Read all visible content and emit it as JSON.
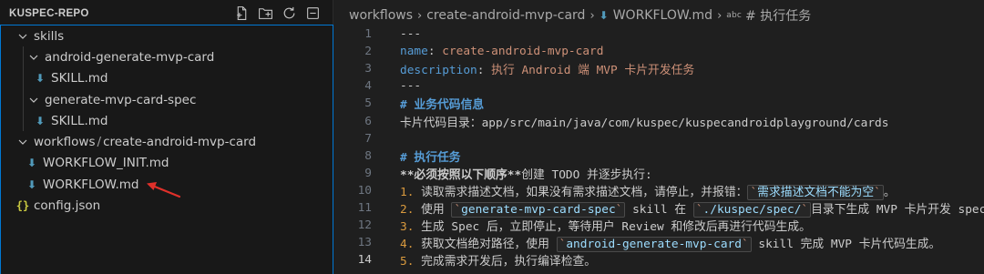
{
  "explorer": {
    "title": "KUSPEC-REPO",
    "actions": [
      "new-file-icon",
      "new-folder-icon",
      "refresh-icon",
      "collapse-all-icon"
    ],
    "items": [
      {
        "label": "skills",
        "type": "folder"
      },
      {
        "label": "android-generate-mvp-card",
        "type": "folder"
      },
      {
        "label": "SKILL.md",
        "type": "md"
      },
      {
        "label": "generate-mvp-card-spec",
        "type": "folder"
      },
      {
        "label": "SKILL.md",
        "type": "md"
      },
      {
        "label_a": "workflows",
        "sep": "/",
        "label_b": "create-android-mvp-card",
        "type": "folder"
      },
      {
        "label": "WORKFLOW_INIT.md",
        "type": "md"
      },
      {
        "label": "WORKFLOW.md",
        "type": "md"
      },
      {
        "label": "config.json",
        "type": "json",
        "icon": "{}"
      }
    ]
  },
  "breadcrumb": {
    "part1": "workflows",
    "part2": "create-android-mvp-card",
    "part3": "WORKFLOW.md",
    "abc": "abc",
    "part4": "# 执行任务"
  },
  "editor": {
    "active_line": 14,
    "line_numbers": [
      "1",
      "2",
      "3",
      "4",
      "5",
      "6",
      "7",
      "8",
      "9",
      "10",
      "11",
      "12",
      "13",
      "14"
    ],
    "l1": "---",
    "l2_key": "name",
    "l2_colon": ": ",
    "l2_val": "create-android-mvp-card",
    "l3_key": "description",
    "l3_colon": ": ",
    "l3_val": "执行 Android 端 MVP 卡片开发任务",
    "l4": "---",
    "l5": "# 业务代码信息",
    "l6": "卡片代码目录：app/src/main/java/com/kuspec/kuspecandroidplayground/cards",
    "l8": "# 执行任务",
    "l9_bold": "**必须按照以下顺序**",
    "l9_rest": "创建 TODO 并逐步执行:",
    "l10_num": "1.",
    "l10_a": " 读取需求描述文档，如果没有需求描述文档，请停止，并报错：",
    "l10_code": "需求描述文档不能为空",
    "l10_b": "。",
    "l11_num": "2.",
    "l11_a": " 使用 ",
    "l11_code": "generate-mvp-card-spec",
    "l11_b": " skill 在 ",
    "l11_code2": "./kuspec/spec/",
    "l11_c": "目录下生成 MVP 卡片开发 spec。",
    "l12_num": "3.",
    "l12_a": " 生成 Spec 后，立即停止，等待用户 Review 和修改后再进行代码生成。",
    "l13_num": "4.",
    "l13_a": " 获取文档绝对路径，使用 ",
    "l13_code": "android-generate-mvp-card",
    "l13_b": " skill 完成 MVP 卡片代码生成。",
    "l14_num": "5.",
    "l14_a": " 完成需求开发后，执行编译检查。",
    "tick": "`"
  },
  "colors": {
    "accent": "#0078d4",
    "yaml_key": "#569cd6",
    "string": "#ce9178",
    "list_number": "#d99a3e",
    "md_icon": "#519aba",
    "annotation_arrow": "#e0302a"
  }
}
